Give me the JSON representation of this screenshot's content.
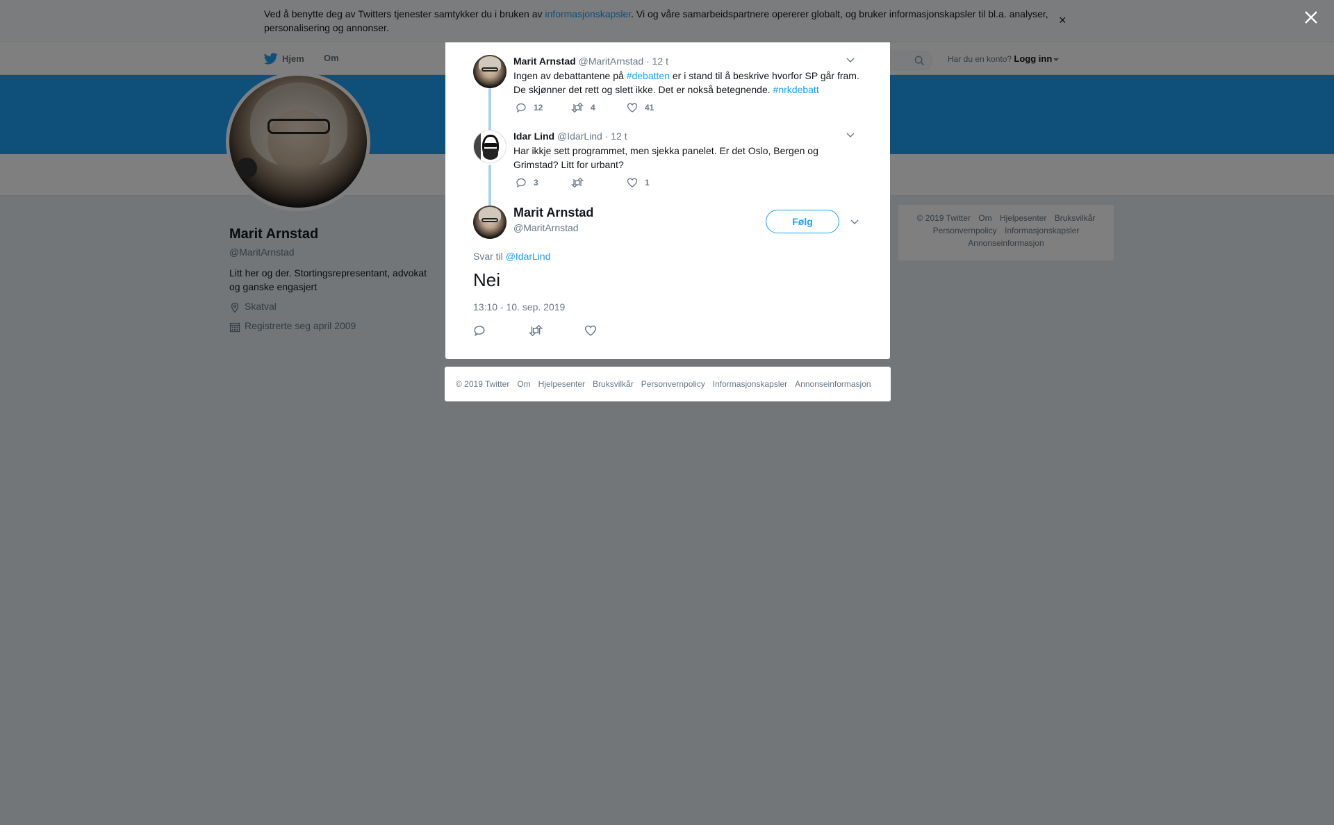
{
  "cookie": {
    "text_before": "Ved å benytte deg av Twitters tjenester samtykker du i bruken av ",
    "link": "informasjonskapsler",
    "text_after": ". Vi og våre samarbeidspartnere opererer globalt, og bruker informasjonskapsler til bl.a. analyser, personalisering og annonser.",
    "close": "×"
  },
  "nav": {
    "home": "Hjem",
    "about": "Om",
    "login_prompt": "Har du en konto?",
    "login": "Logg inn"
  },
  "profile": {
    "name": "Marit Arnstad",
    "handle": "@MaritArnstad",
    "bio": "Litt her og der. Stortingsrepresentant, advokat og ganske engasjert",
    "location": "Skatval",
    "joined": "Registrerte seg april 2009"
  },
  "side_footer": [
    "© 2019 Twitter",
    "Om",
    "Hjelpesenter",
    "Bruksvilkår",
    "Personvernpolicy",
    "Informasjonskapsler",
    "Annonseinformasjon"
  ],
  "tweets": [
    {
      "name": "Marit Arnstad",
      "handle": "@MaritArnstad",
      "time": "· 12 t",
      "text_1": "Ingen av debattantene på ",
      "hashtag_1": "#debatten",
      "text_2": " er i stand til å beskrive hvorfor SP går fram. De skjønner det rett og slett ikke. Det er nokså betegnende. ",
      "hashtag_2": "#nrkdebatt",
      "replies": "12",
      "retweets": "4",
      "likes": "41"
    },
    {
      "name": "Idar Lind",
      "handle": "@IdarLind",
      "time": "· 12 t",
      "text": "Har ikkje sett programmet, men sjekka panelet. Er det Oslo, Bergen og Grimstad? Litt for urbant?",
      "replies": "3",
      "retweets": "",
      "likes": "1"
    }
  ],
  "main_tweet": {
    "name": "Marit Arnstad",
    "handle": "@MaritArnstad",
    "follow": "Følg",
    "reply_prefix": "Svar til",
    "reply_to": "@IdarLind",
    "text": "Nei",
    "date": "13:10 - 10. sep. 2019"
  },
  "modal_footer": [
    "© 2019 Twitter",
    "Om",
    "Hjelpesenter",
    "Bruksvilkår",
    "Personvernpolicy",
    "Informasjonskapsler",
    "Annonseinformasjon"
  ],
  "colors": {
    "accent": "#1da1f2",
    "thread_line": "#a8d4f2",
    "overlay": "rgba(0,0,0,0.5)"
  }
}
